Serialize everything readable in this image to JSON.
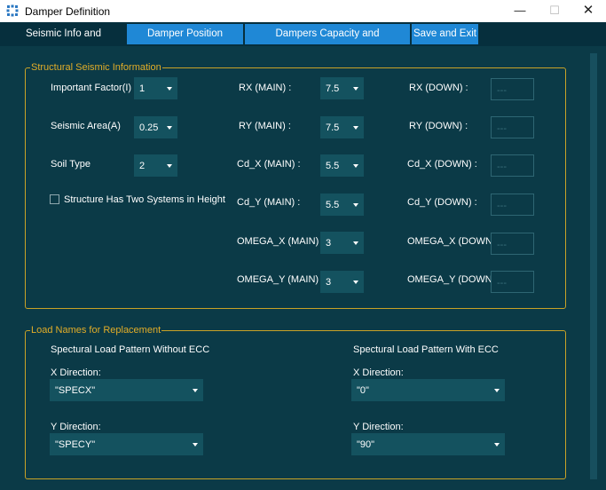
{
  "window": {
    "title": "Damper Definition",
    "minimize": "—",
    "maximize": "☐",
    "close": "✕"
  },
  "tabs": [
    {
      "label": "Seismic Info and Loadcases."
    },
    {
      "label": "Damper Position"
    },
    {
      "label": "Dampers Capacity and Manufacturers"
    },
    {
      "label": "Save and Exit"
    }
  ],
  "seismic": {
    "legend": "Structural Seismic Information",
    "important_factor": {
      "label": "Important Factor(I)",
      "value": "1"
    },
    "seismic_area": {
      "label": "Seismic Area(A)",
      "value": "0.25"
    },
    "soil_type": {
      "label": "Soil Type",
      "value": "2"
    },
    "two_systems": {
      "label": "Structure Has Two Systems in Height",
      "checked": false
    },
    "main": [
      {
        "label": "RX (MAIN) :",
        "value": "7.5"
      },
      {
        "label": "RY (MAIN) :",
        "value": "7.5"
      },
      {
        "label": "Cd_X (MAIN) :",
        "value": "5.5"
      },
      {
        "label": "Cd_Y (MAIN) :",
        "value": "5.5"
      },
      {
        "label": "OMEGA_X (MAIN) :",
        "value": "3"
      },
      {
        "label": "OMEGA_Y (MAIN) :",
        "value": "3"
      }
    ],
    "down": [
      {
        "label": "RX (DOWN) :",
        "value": "---"
      },
      {
        "label": "RY (DOWN) :",
        "value": "---"
      },
      {
        "label": "Cd_X (DOWN) :",
        "value": "---"
      },
      {
        "label": "Cd_Y (DOWN) :",
        "value": "---"
      },
      {
        "label": "OMEGA_X (DOWN) :",
        "value": "---"
      },
      {
        "label": "OMEGA_Y (DOWN) :",
        "value": "---"
      }
    ]
  },
  "loads": {
    "legend": "Load Names for Replacement",
    "without_ecc": {
      "title": "Spectural Load Pattern Without ECC",
      "x_label": "X Direction:",
      "x_value": "\"SPECX\"",
      "y_label": "Y Direction:",
      "y_value": "\"SPECY\""
    },
    "with_ecc": {
      "title": "Spectural Load Pattern With ECC",
      "x_label": "X Direction:",
      "x_value": "\"0\"",
      "y_label": "Y Direction:",
      "y_value": "\"90\""
    }
  },
  "colors": {
    "background": "#0b3a47",
    "tab_accent": "#1f88d6",
    "group_border": "#c9a227",
    "legend_text": "#e2ad28"
  },
  "icons": {
    "app": "grid-dots-icon",
    "dropdown": "triangle-down-icon"
  }
}
